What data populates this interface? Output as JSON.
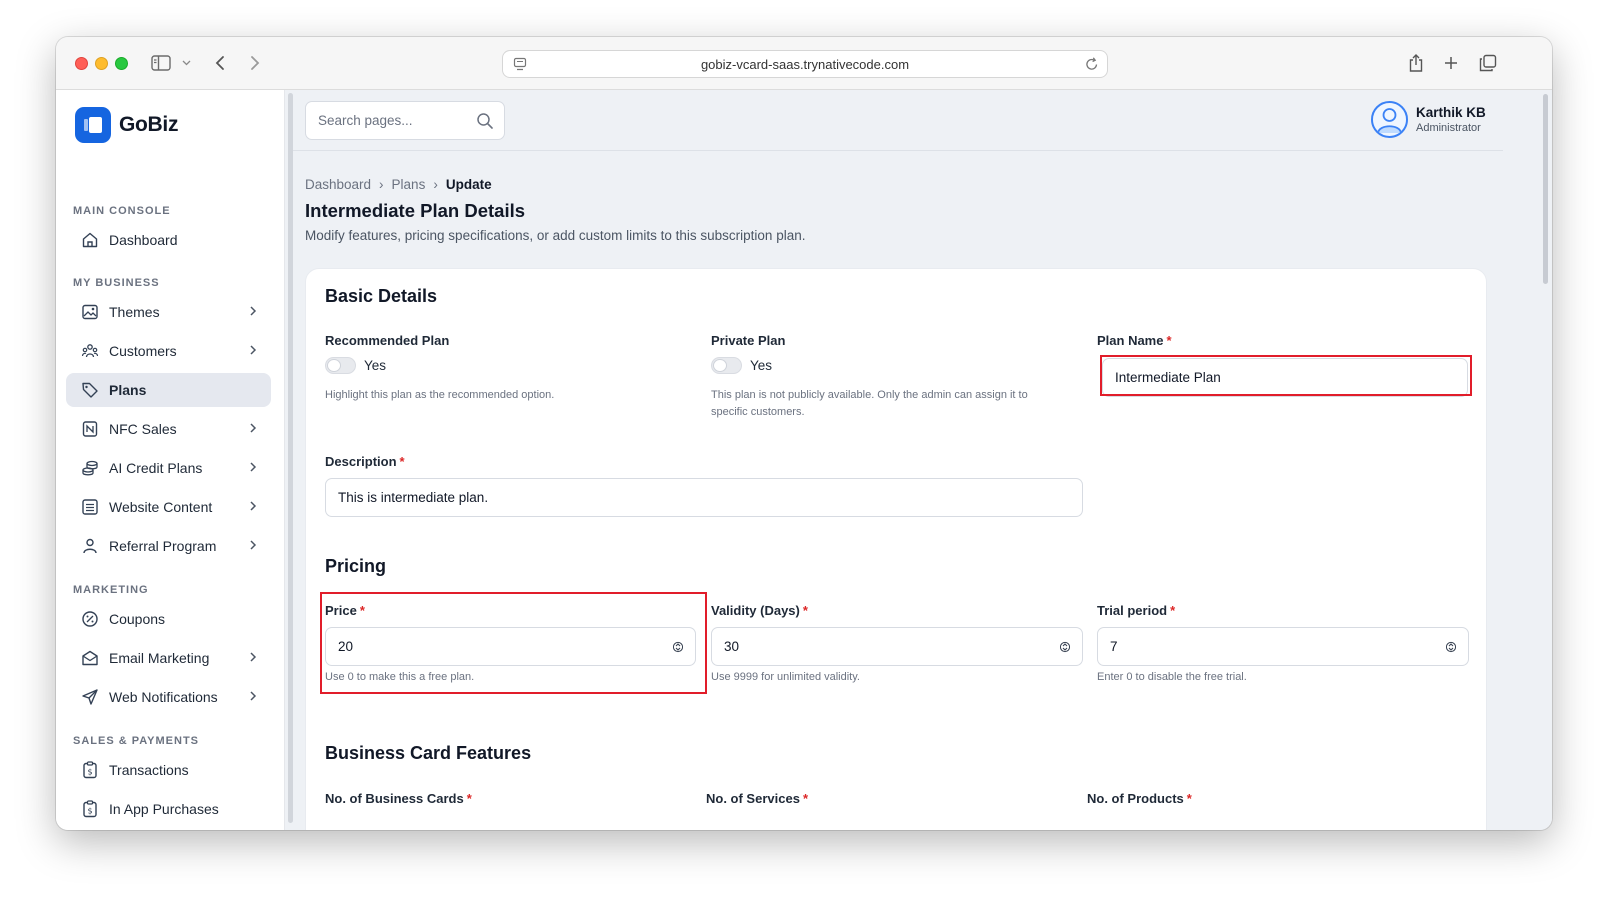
{
  "browser": {
    "url": "gobiz-vcard-saas.trynativecode.com"
  },
  "brand": {
    "name": "GoBiz"
  },
  "sidebar": {
    "sections": [
      {
        "title": "MAIN CONSOLE"
      },
      {
        "title": "MY BUSINESS"
      },
      {
        "title": "MARKETING"
      },
      {
        "title": "SALES & PAYMENTS"
      }
    ],
    "items": [
      {
        "label": "Dashboard",
        "icon": "home-icon",
        "has_chevron": false
      },
      {
        "label": "Themes",
        "icon": "image-icon",
        "has_chevron": true
      },
      {
        "label": "Customers",
        "icon": "users-icon",
        "has_chevron": true
      },
      {
        "label": "Plans",
        "icon": "tag-icon",
        "has_chevron": false,
        "active": true
      },
      {
        "label": "NFC Sales",
        "icon": "nfc-icon",
        "has_chevron": true
      },
      {
        "label": "AI Credit Plans",
        "icon": "coins-icon",
        "has_chevron": true
      },
      {
        "label": "Website Content",
        "icon": "list-icon",
        "has_chevron": true
      },
      {
        "label": "Referral Program",
        "icon": "person-icon",
        "has_chevron": true
      },
      {
        "label": "Coupons",
        "icon": "discount-icon",
        "has_chevron": false
      },
      {
        "label": "Email Marketing",
        "icon": "mail-icon",
        "has_chevron": true
      },
      {
        "label": "Web Notifications",
        "icon": "send-icon",
        "has_chevron": true
      },
      {
        "label": "Transactions",
        "icon": "receipt-icon",
        "has_chevron": false
      },
      {
        "label": "In App Purchases",
        "icon": "receipt-icon",
        "has_chevron": false
      }
    ]
  },
  "header": {
    "search_placeholder": "Search pages...",
    "user_name": "Karthik KB",
    "user_role": "Administrator"
  },
  "breadcrumb": [
    "Dashboard",
    "Plans",
    "Update"
  ],
  "page": {
    "title": "Intermediate Plan Details",
    "subtitle": "Modify features, pricing specifications, or add custom limits to this subscription plan."
  },
  "basic": {
    "heading": "Basic Details",
    "recommended_label": "Recommended Plan",
    "recommended_toggle": "Yes",
    "recommended_help": "Highlight this plan as the recommended option.",
    "private_label": "Private Plan",
    "private_toggle": "Yes",
    "private_help_1": "This plan is not publicly available. Only the admin can assign it to",
    "private_help_2": "specific customers.",
    "plan_name_label": "Plan Name",
    "plan_name_value": "Intermediate Plan",
    "description_label": "Description",
    "description_value": "This is intermediate plan.",
    "required_mark": "*"
  },
  "pricing": {
    "heading": "Pricing",
    "price_label": "Price",
    "price_value": "20",
    "price_help": "Use 0 to make this a free plan.",
    "validity_label": "Validity (Days)",
    "validity_value": "30",
    "validity_help": "Use 9999 for unlimited validity.",
    "trial_label": "Trial period",
    "trial_value": "7",
    "trial_help": "Enter 0 to disable the free trial."
  },
  "features": {
    "heading": "Business Card Features",
    "cards_label": "No. of Business Cards",
    "services_label": "No. of Services",
    "products_label": "No. of Products"
  },
  "colors": {
    "brand": "#1565e0",
    "highlight": "#e11d2a",
    "required": "#dc2626"
  }
}
